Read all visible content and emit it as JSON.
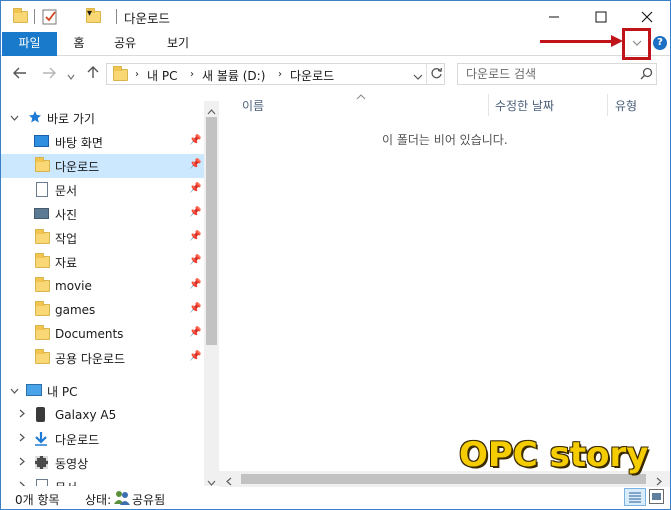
{
  "window": {
    "title": "다운로드",
    "minimize": "—",
    "maximize": "☐",
    "close": "✕"
  },
  "ribbon": {
    "tabs": [
      "파일",
      "홈",
      "공유",
      "보기"
    ],
    "expand_icon": "chevron-down-icon",
    "help": "?"
  },
  "address": {
    "crumbs": [
      "내 PC",
      "새 볼륨 (D:)",
      "다운로드"
    ],
    "search_placeholder": "다운로드 검색"
  },
  "nav": {
    "quick_access": "바로 가기",
    "quick_items": [
      {
        "label": "바탕 화면",
        "icon": "desktop-icon"
      },
      {
        "label": "다운로드",
        "icon": "folder-icon"
      },
      {
        "label": "문서",
        "icon": "document-icon"
      },
      {
        "label": "사진",
        "icon": "picture-icon"
      },
      {
        "label": "작업",
        "icon": "folder-icon"
      },
      {
        "label": "자료",
        "icon": "folder-icon"
      },
      {
        "label": "movie",
        "icon": "folder-icon"
      },
      {
        "label": "games",
        "icon": "folder-icon"
      },
      {
        "label": "Documents",
        "icon": "folder-icon"
      },
      {
        "label": "공용 다운로드",
        "icon": "folder-icon"
      }
    ],
    "this_pc": "내 PC",
    "pc_items": [
      {
        "label": "Galaxy A5",
        "icon": "phone-icon"
      },
      {
        "label": "다운로드",
        "icon": "download-icon"
      },
      {
        "label": "동영상",
        "icon": "video-icon"
      },
      {
        "label": "문서",
        "icon": "document-icon"
      }
    ]
  },
  "columns": {
    "name": "이름",
    "modified": "수정한 날짜",
    "type": "유형"
  },
  "empty_message": "이 폴더는 비어 있습니다.",
  "status": {
    "count": "0개 항목",
    "state_label": "상태:",
    "state_value": "공유됨"
  },
  "watermark": "OPC story",
  "colors": {
    "accent": "#1979ca",
    "selection": "#cce8ff",
    "annotation": "#c0141b",
    "watermark": "#f4cc00"
  }
}
